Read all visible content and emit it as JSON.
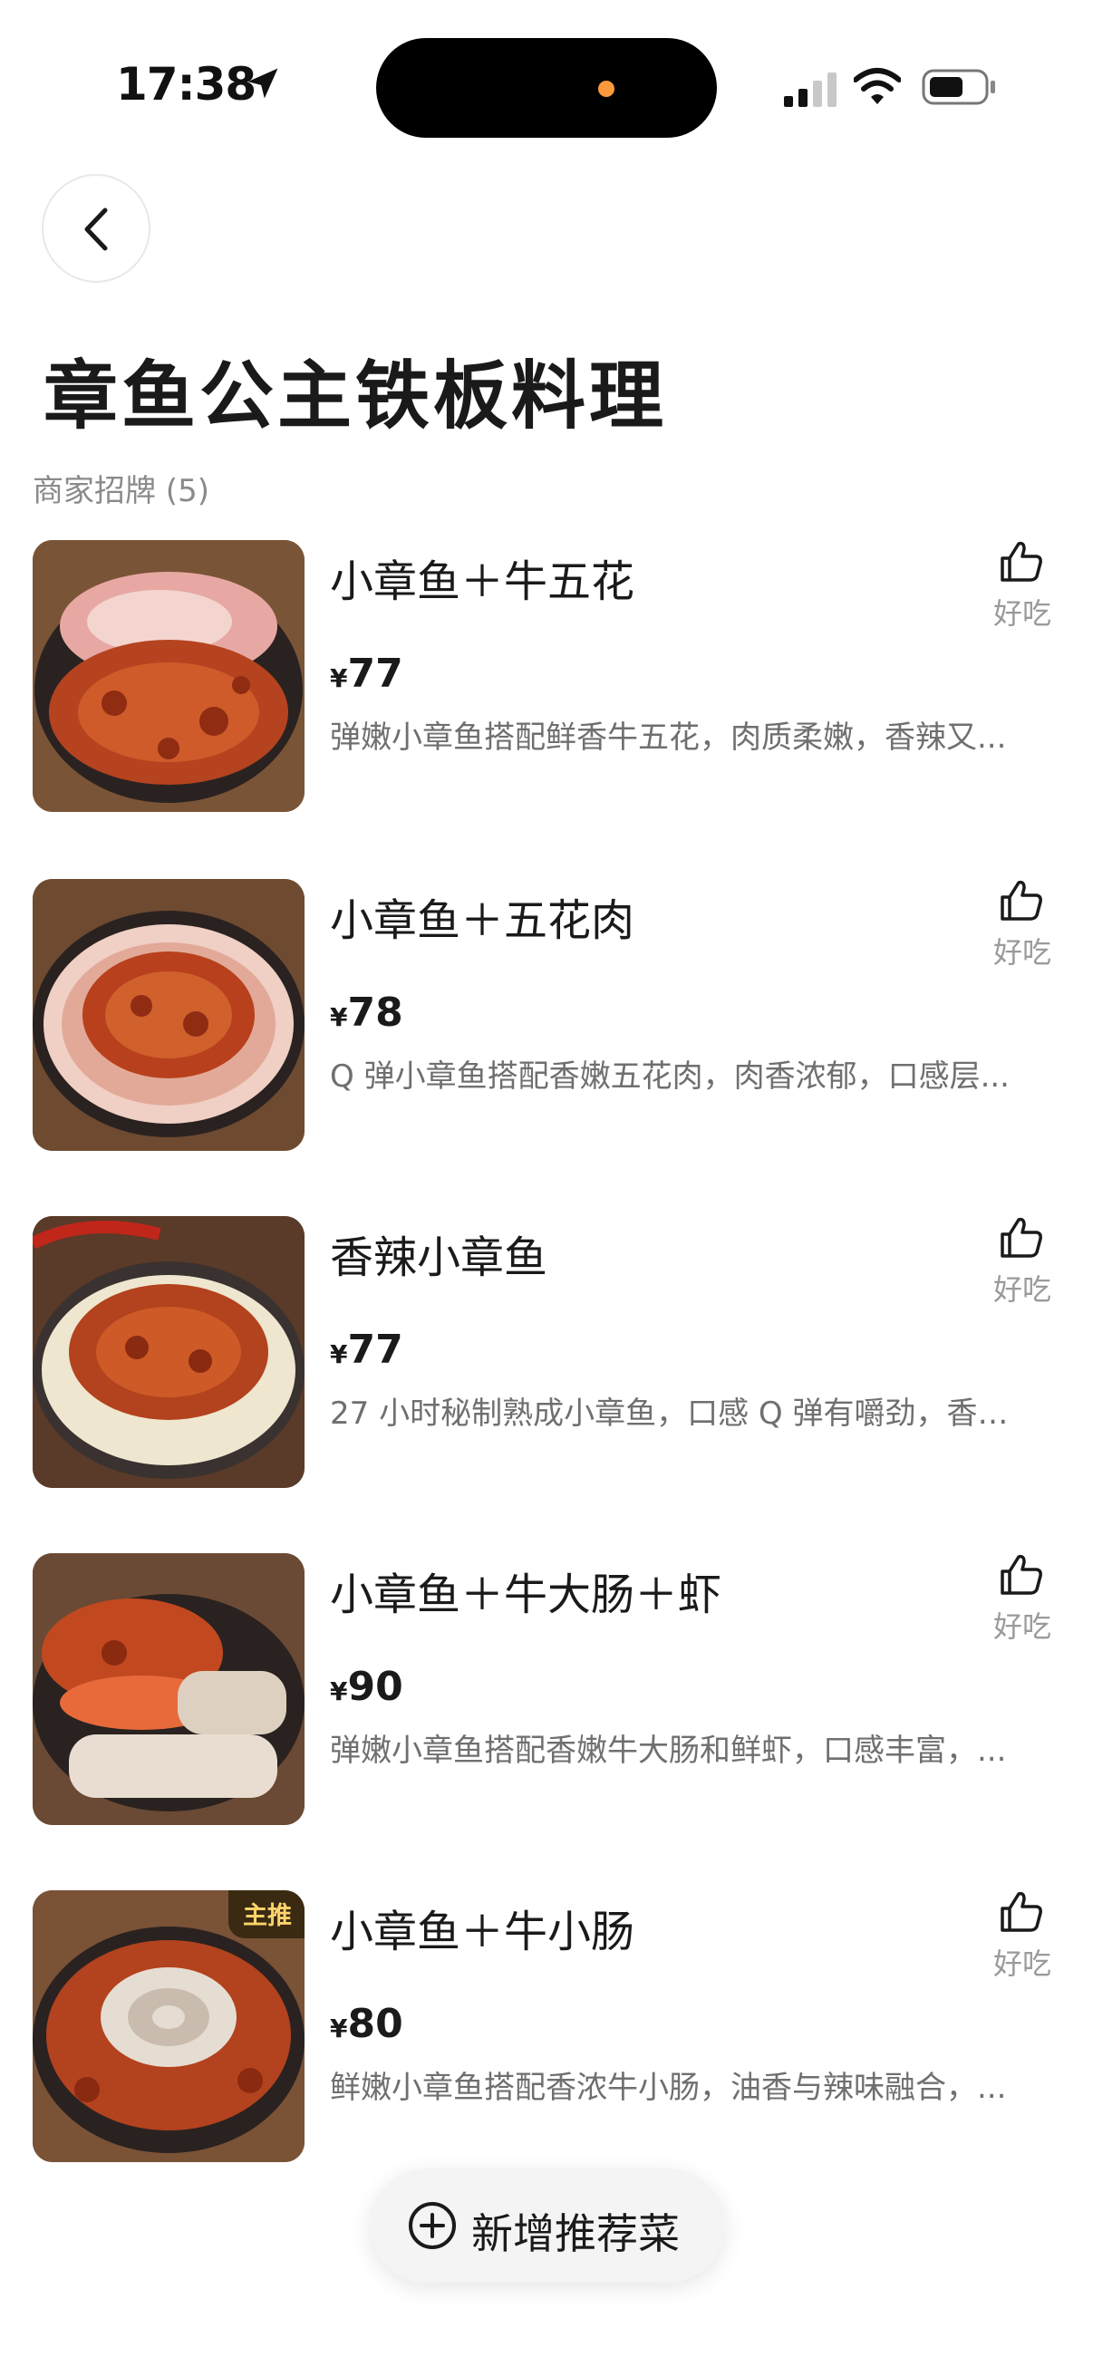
{
  "status_bar": {
    "time": "17:38"
  },
  "header": {
    "title": "章鱼公主铁板料理"
  },
  "section": {
    "label": "商家招牌 (5)"
  },
  "items": [
    {
      "name": "小章鱼＋牛五花",
      "currency": "¥",
      "price": "77",
      "desc": "弹嫩小章鱼搭配鲜香牛五花，肉质柔嫩，香辣又...",
      "like_label": "好吃"
    },
    {
      "name": "小章鱼＋五花肉",
      "currency": "¥",
      "price": "78",
      "desc": "Q 弹小章鱼搭配香嫩五花肉，肉香浓郁，口感层...",
      "like_label": "好吃"
    },
    {
      "name": "香辣小章鱼",
      "currency": "¥",
      "price": "77",
      "desc": "27 小时秘制熟成小章鱼，口感 Q 弹有嚼劲，香辣...",
      "like_label": "好吃"
    },
    {
      "name": "小章鱼＋牛大肠＋虾",
      "currency": "¥",
      "price": "90",
      "desc": "弹嫩小章鱼搭配香嫩牛大肠和鲜虾，口感丰富，...",
      "like_label": "好吃"
    },
    {
      "name": "小章鱼＋牛小肠",
      "currency": "¥",
      "price": "80",
      "desc": "鲜嫩小章鱼搭配香浓牛小肠，油香与辣味融合，...",
      "like_label": "好吃",
      "badge": "主推"
    }
  ],
  "fab": {
    "label": "新增推荐菜"
  },
  "icons": [
    "location-arrow-icon",
    "cellular-signal-icon",
    "wifi-icon",
    "battery-icon",
    "back-chevron-icon",
    "thumbs-up-icon",
    "add-circle-icon"
  ],
  "colors": {
    "accent_dot": "#ff9a3c",
    "badge_bg": "#3a2a12",
    "badge_text": "#ffd36b"
  }
}
